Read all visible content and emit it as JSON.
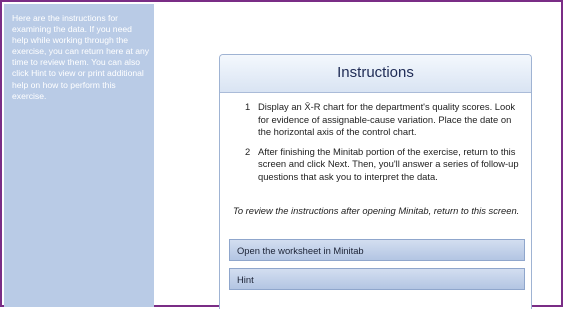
{
  "sidebar": {
    "help_text": "Here are the instructions for examining the data. If you need help while working through the exercise, you can return here at any time to review them. You can also click Hint to view or print additional help on how to perform this exercise."
  },
  "panel": {
    "title": "Instructions",
    "steps": [
      {
        "number": "1",
        "text": "Display an X̄-R chart for the department's quality scores. Look for evidence of assignable-cause variation. Place the date on the horizontal axis of the control chart."
      },
      {
        "number": "2",
        "text": "After finishing the Minitab portion of the exercise, return to this screen and click Next. Then, you'll answer a series of follow-up questions that ask you to interpret the data."
      }
    ],
    "note": "To review the instructions after opening Minitab, return to this screen."
  },
  "buttons": {
    "open_worksheet": "Open the worksheet in Minitab",
    "hint": "Hint"
  },
  "colors": {
    "frame_border": "#7a2d86",
    "sidebar_bg": "#b9cbe6",
    "button_bg": "#b3c5e3",
    "title_text": "#1f2b55"
  }
}
